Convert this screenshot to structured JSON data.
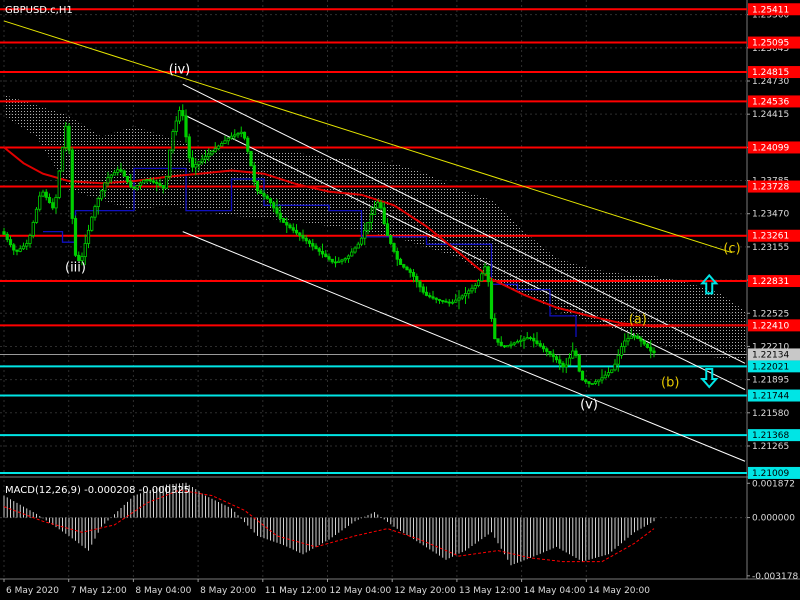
{
  "window": {
    "symbol_title": "GBPUSD.c,H1"
  },
  "colors": {
    "background": "#000000",
    "grid": "#2e2e2e",
    "candle": "#00d000",
    "support": "#00e5e5",
    "resistance": "#ff0000",
    "ma": "#e00000",
    "channel": "#ffffff",
    "trendline": "#e5e500",
    "band": "#1010c0",
    "price_marker": "#9a9a9a",
    "macd_hist": "#d0d0d0",
    "macd_signal": "#ff0000"
  },
  "chart_data": [
    {
      "type": "candlestick",
      "title": "GBPUSD.c,H1",
      "ylim": [
        1.2098,
        1.2548
      ],
      "y_ticks": [
        {
          "value": 1.2536,
          "label": "1.25360"
        },
        {
          "value": 1.25045,
          "label": "1.25045"
        },
        {
          "value": 1.2473,
          "label": "1.24730"
        },
        {
          "value": 1.24415,
          "label": "1.24415"
        },
        {
          "value": 1.241,
          "label": "1.24100"
        },
        {
          "value": 1.23785,
          "label": "1.23785"
        },
        {
          "value": 1.2347,
          "label": "1.23470"
        },
        {
          "value": 1.23155,
          "label": "1.23155"
        },
        {
          "value": 1.2284,
          "label": "1.22840"
        },
        {
          "value": 1.22525,
          "label": "1.22525"
        },
        {
          "value": 1.2221,
          "label": "1.22210"
        },
        {
          "value": 1.21895,
          "label": "1.21895"
        },
        {
          "value": 1.2158,
          "label": "1.21580"
        },
        {
          "value": 1.21265,
          "label": "1.21265"
        }
      ],
      "x_labels": [
        "6 May 2020",
        "7 May 12:00",
        "8 May 04:00",
        "8 May 20:00",
        "11 May 12:00",
        "12 May 04:00",
        "12 May 20:00",
        "13 May 12:00",
        "14 May 04:00",
        "14 May 20:00"
      ],
      "current_price": {
        "value": 1.22134,
        "label": "1.22134"
      },
      "levels": [
        {
          "value": 1.25411,
          "label": "1.25411",
          "kind": "resistance"
        },
        {
          "value": 1.25095,
          "label": "1.25095",
          "kind": "resistance"
        },
        {
          "value": 1.24815,
          "label": "1.24815",
          "kind": "resistance"
        },
        {
          "value": 1.24536,
          "label": "1.24536",
          "kind": "resistance"
        },
        {
          "value": 1.24099,
          "label": "1.24099",
          "kind": "resistance"
        },
        {
          "value": 1.23728,
          "label": "1.23728",
          "kind": "resistance"
        },
        {
          "value": 1.23261,
          "label": "1.23261",
          "kind": "resistance"
        },
        {
          "value": 1.22831,
          "label": "1.22831",
          "kind": "resistance"
        },
        {
          "value": 1.2241,
          "label": "1.22410",
          "kind": "resistance"
        },
        {
          "value": 1.22021,
          "label": "1.22021",
          "kind": "support"
        },
        {
          "value": 1.21744,
          "label": "1.21744",
          "kind": "support"
        },
        {
          "value": 1.21368,
          "label": "1.21368",
          "kind": "support"
        },
        {
          "value": 1.21009,
          "label": "1.21009",
          "kind": "support"
        }
      ],
      "wave_labels": [
        {
          "text": "(iv)",
          "bar": 54,
          "price": 1.248,
          "color": "#ffffff"
        },
        {
          "text": "(iii)",
          "bar": 22,
          "price": 1.2292,
          "color": "#ffffff"
        },
        {
          "text": "(v)",
          "bar": 180,
          "price": 1.2162,
          "color": "#ffffff"
        },
        {
          "text": "(a)",
          "bar": 195,
          "price": 1.2243,
          "color": "#e5c800"
        },
        {
          "text": "(b)",
          "bar": 205,
          "price": 1.2183,
          "color": "#e5c800"
        },
        {
          "text": "(c)",
          "bar": 224,
          "price": 1.231,
          "color": "#e5c800"
        }
      ],
      "price_path": [
        [
          0,
          1.233
        ],
        [
          4,
          1.231
        ],
        [
          8,
          1.232
        ],
        [
          12,
          1.237
        ],
        [
          16,
          1.235
        ],
        [
          18,
          1.24
        ],
        [
          20,
          1.244
        ],
        [
          22,
          1.231
        ],
        [
          24,
          1.23
        ],
        [
          28,
          1.235
        ],
        [
          32,
          1.238
        ],
        [
          36,
          1.239
        ],
        [
          40,
          1.237
        ],
        [
          44,
          1.238
        ],
        [
          48,
          1.2375
        ],
        [
          50,
          1.237
        ],
        [
          52,
          1.242
        ],
        [
          55,
          1.245
        ],
        [
          58,
          1.239
        ],
        [
          62,
          1.24
        ],
        [
          66,
          1.241
        ],
        [
          70,
          1.242
        ],
        [
          74,
          1.2425
        ],
        [
          76,
          1.24
        ],
        [
          78,
          1.237
        ],
        [
          82,
          1.236
        ],
        [
          86,
          1.234
        ],
        [
          90,
          1.233
        ],
        [
          94,
          1.232
        ],
        [
          98,
          1.231
        ],
        [
          102,
          1.23
        ],
        [
          106,
          1.2305
        ],
        [
          110,
          1.232
        ],
        [
          114,
          1.235
        ],
        [
          116,
          1.236
        ],
        [
          118,
          1.233
        ],
        [
          122,
          1.23
        ],
        [
          126,
          1.229
        ],
        [
          130,
          1.227
        ],
        [
          134,
          1.2265
        ],
        [
          138,
          1.2262
        ],
        [
          142,
          1.227
        ],
        [
          146,
          1.228
        ],
        [
          149,
          1.23
        ],
        [
          151,
          1.223
        ],
        [
          154,
          1.222
        ],
        [
          158,
          1.2225
        ],
        [
          162,
          1.223
        ],
        [
          166,
          1.222
        ],
        [
          170,
          1.221
        ],
        [
          173,
          1.22
        ],
        [
          176,
          1.222
        ],
        [
          178,
          1.219
        ],
        [
          181,
          1.2185
        ],
        [
          184,
          1.219
        ],
        [
          188,
          1.22
        ],
        [
          191,
          1.2225
        ],
        [
          194,
          1.2232
        ],
        [
          197,
          1.2225
        ],
        [
          200,
          1.2215
        ]
      ],
      "ma_path": [
        [
          0,
          1.241
        ],
        [
          6,
          1.2395
        ],
        [
          12,
          1.2385
        ],
        [
          20,
          1.2378
        ],
        [
          30,
          1.2376
        ],
        [
          40,
          1.2378
        ],
        [
          50,
          1.2382
        ],
        [
          60,
          1.2385
        ],
        [
          70,
          1.2388
        ],
        [
          80,
          1.2385
        ],
        [
          90,
          1.2375
        ],
        [
          100,
          1.2368
        ],
        [
          110,
          1.2365
        ],
        [
          120,
          1.2355
        ],
        [
          130,
          1.2335
        ],
        [
          140,
          1.231
        ],
        [
          150,
          1.2285
        ],
        [
          160,
          1.227
        ],
        [
          170,
          1.2258
        ],
        [
          180,
          1.225
        ],
        [
          190,
          1.2243
        ],
        [
          200,
          1.224
        ],
        [
          210,
          1.2241
        ],
        [
          230,
          1.2241
        ]
      ],
      "band_path": [
        [
          12,
          1.233
        ],
        [
          18,
          1.233
        ],
        [
          18,
          1.232
        ],
        [
          22,
          1.232
        ],
        [
          22,
          1.235
        ],
        [
          40,
          1.235
        ],
        [
          40,
          1.239
        ],
        [
          56,
          1.239
        ],
        [
          56,
          1.235
        ],
        [
          70,
          1.235
        ],
        [
          70,
          1.238
        ],
        [
          80,
          1.238
        ],
        [
          80,
          1.2355
        ],
        [
          100,
          1.2355
        ],
        [
          100,
          1.235
        ],
        [
          110,
          1.235
        ],
        [
          110,
          1.2325
        ],
        [
          130,
          1.2325
        ],
        [
          130,
          1.2318
        ],
        [
          150,
          1.2318
        ],
        [
          150,
          1.228
        ],
        [
          158,
          1.228
        ],
        [
          158,
          1.2275
        ],
        [
          168,
          1.2275
        ],
        [
          168,
          1.225
        ],
        [
          176,
          1.225
        ],
        [
          176,
          1.223
        ]
      ],
      "cloud_upper": [
        [
          0,
          1.246
        ],
        [
          10,
          1.245
        ],
        [
          20,
          1.244
        ],
        [
          30,
          1.242
        ],
        [
          40,
          1.243
        ],
        [
          50,
          1.242
        ],
        [
          60,
          1.241
        ],
        [
          70,
          1.2405
        ],
        [
          90,
          1.2405
        ],
        [
          100,
          1.24
        ],
        [
          110,
          1.2398
        ],
        [
          120,
          1.2395
        ],
        [
          130,
          1.2385
        ],
        [
          140,
          1.237
        ],
        [
          150,
          1.236
        ],
        [
          160,
          1.233
        ],
        [
          170,
          1.2305
        ],
        [
          180,
          1.2295
        ],
        [
          190,
          1.229
        ],
        [
          200,
          1.2288
        ],
        [
          210,
          1.2282
        ],
        [
          220,
          1.2272
        ],
        [
          228,
          1.2255
        ]
      ],
      "cloud_lower": [
        [
          0,
          1.244
        ],
        [
          10,
          1.242
        ],
        [
          20,
          1.237
        ],
        [
          30,
          1.236
        ],
        [
          40,
          1.235
        ],
        [
          50,
          1.2355
        ],
        [
          60,
          1.235
        ],
        [
          70,
          1.2345
        ],
        [
          90,
          1.234
        ],
        [
          100,
          1.2335
        ],
        [
          110,
          1.233
        ],
        [
          120,
          1.2325
        ],
        [
          130,
          1.2315
        ],
        [
          140,
          1.2305
        ],
        [
          150,
          1.2285
        ],
        [
          160,
          1.227
        ],
        [
          170,
          1.2255
        ],
        [
          180,
          1.2245
        ],
        [
          190,
          1.2236
        ],
        [
          200,
          1.2225
        ],
        [
          210,
          1.2215
        ],
        [
          220,
          1.221
        ],
        [
          228,
          1.2208
        ]
      ],
      "trend_lines": [
        {
          "kind": "channel",
          "from": [
            55,
            1.247
          ],
          "to": [
            228,
            1.2205
          ]
        },
        {
          "kind": "channel",
          "from": [
            56,
            1.244
          ],
          "to": [
            228,
            1.218
          ]
        },
        {
          "kind": "channel",
          "from": [
            55,
            1.233
          ],
          "to": [
            228,
            1.2112
          ]
        },
        {
          "kind": "trendline",
          "from": [
            0,
            1.253
          ],
          "to": [
            224,
            1.231
          ]
        }
      ],
      "arrows": [
        {
          "direction": "up",
          "bar": 217,
          "price": 1.2279
        },
        {
          "direction": "down",
          "bar": 217,
          "price": 1.2192
        }
      ]
    },
    {
      "type": "histogram",
      "title": "MACD(12,26,9) -0.000208 -0.000325",
      "ylim": [
        -0.00335,
        0.00205
      ],
      "y_ticks": [
        {
          "value": 0.001872,
          "label": "0.001872"
        },
        {
          "value": 0.0,
          "label": "0.000000"
        },
        {
          "value": -0.003178,
          "label": "-0.003178"
        }
      ],
      "hist_path": [
        [
          0,
          0.0012
        ],
        [
          10,
          0.0002
        ],
        [
          20,
          -0.001
        ],
        [
          26,
          -0.0018
        ],
        [
          30,
          -0.0005
        ],
        [
          40,
          0.0012
        ],
        [
          50,
          0.0018
        ],
        [
          56,
          0.0019
        ],
        [
          62,
          0.0012
        ],
        [
          70,
          0.0005
        ],
        [
          78,
          -0.001
        ],
        [
          86,
          -0.0015
        ],
        [
          92,
          -0.002
        ],
        [
          100,
          -0.0012
        ],
        [
          108,
          -0.0002
        ],
        [
          114,
          0.0003
        ],
        [
          120,
          -0.0005
        ],
        [
          128,
          -0.0014
        ],
        [
          136,
          -0.0023
        ],
        [
          142,
          -0.0018
        ],
        [
          150,
          -0.0008
        ],
        [
          156,
          -0.0026
        ],
        [
          162,
          -0.0022
        ],
        [
          170,
          -0.0016
        ],
        [
          178,
          -0.0024
        ],
        [
          186,
          -0.002
        ],
        [
          194,
          -0.0008
        ],
        [
          200,
          -0.0002
        ]
      ],
      "signal_path": [
        [
          0,
          0.0006
        ],
        [
          12,
          -0.0002
        ],
        [
          24,
          -0.0008
        ],
        [
          34,
          -0.0004
        ],
        [
          44,
          0.0008
        ],
        [
          54,
          0.0015
        ],
        [
          64,
          0.0012
        ],
        [
          74,
          0.0004
        ],
        [
          84,
          -0.001
        ],
        [
          96,
          -0.0016
        ],
        [
          108,
          -0.001
        ],
        [
          118,
          -0.0006
        ],
        [
          128,
          -0.0012
        ],
        [
          140,
          -0.0021
        ],
        [
          152,
          -0.0018
        ],
        [
          162,
          -0.0022
        ],
        [
          172,
          -0.0024
        ],
        [
          184,
          -0.0024
        ],
        [
          194,
          -0.0014
        ],
        [
          200,
          -0.0006
        ]
      ]
    }
  ]
}
